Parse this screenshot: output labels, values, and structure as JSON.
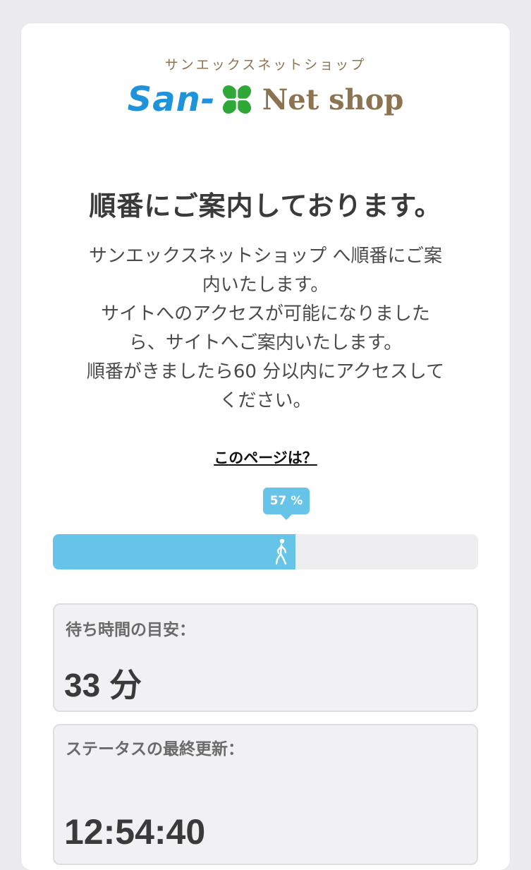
{
  "brand": {
    "kana": "サンエックスネットショップ",
    "name_left": "San-",
    "name_right": "Net shop",
    "accent_blue": "#1e93dc",
    "accent_brown": "#8c7452",
    "clover_color": "#2fa838"
  },
  "title": "順番にご案内しております。",
  "message": [
    "サンエックスネットショップ へ順番にご案",
    "内いたします。",
    "サイトへのアクセスが可能になりました",
    "ら、サイトへご案内いたします。",
    "順番がきましたら60 分以内にアクセスして",
    "ください。"
  ],
  "about_link": "このページは？",
  "progress": {
    "percent": 57,
    "label": "57 %",
    "fill_color": "#67c4e9",
    "icon": "walking-person-icon"
  },
  "wait_time": {
    "label": "待ち時間の目安：",
    "value": "33 分"
  },
  "last_update": {
    "label": "ステータスの最終更新：",
    "value": "12:54:40"
  }
}
